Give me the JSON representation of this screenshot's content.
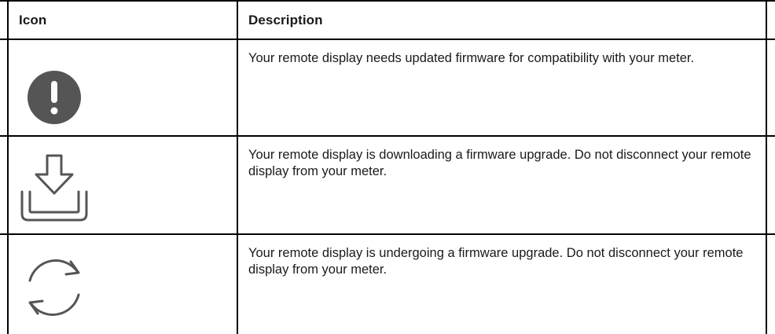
{
  "table": {
    "headers": {
      "icon": "Icon",
      "description": "Description"
    },
    "rows": [
      {
        "icon": "alert-exclamation-icon",
        "description": "Your remote display needs updated firmware for compatibility with your meter."
      },
      {
        "icon": "download-icon",
        "description": "Your remote display is downloading a firmware upgrade. Do not disconnect your remote display from your meter."
      },
      {
        "icon": "sync-refresh-icon",
        "description": "Your remote display is undergoing a firmware upgrade. Do not disconnect your remote display from your meter."
      }
    ]
  },
  "colors": {
    "icon_fill": "#555555",
    "rule": "#000000"
  }
}
